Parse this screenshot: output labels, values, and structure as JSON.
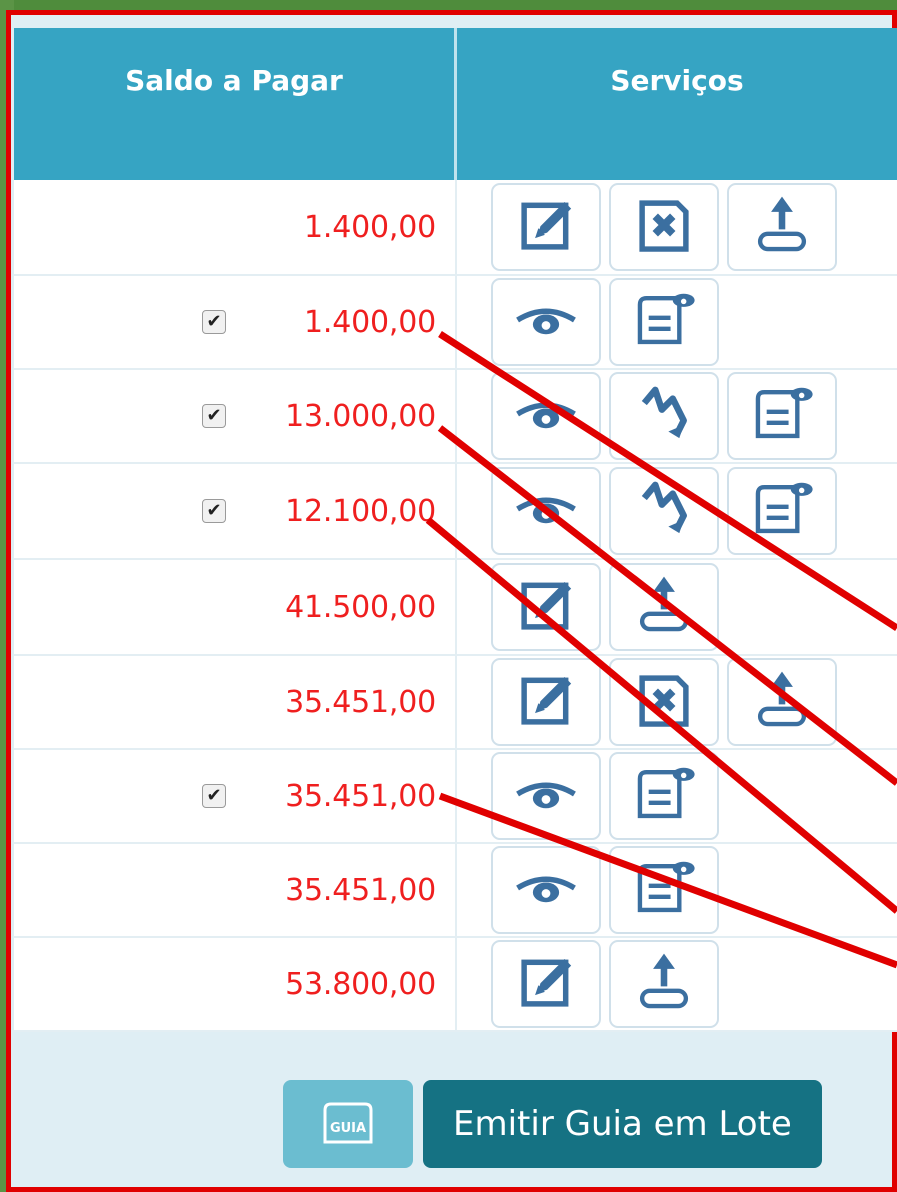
{
  "table": {
    "headers": {
      "saldo": "Saldo a Pagar",
      "servicos": "Serviços"
    },
    "rows": [
      {
        "amount": "1.400,00",
        "checked": false,
        "actions": [
          "edit",
          "delete",
          "upload"
        ]
      },
      {
        "amount": "1.400,00",
        "checked": true,
        "actions": [
          "view",
          "guide"
        ]
      },
      {
        "amount": "13.000,00",
        "checked": true,
        "actions": [
          "view",
          "history",
          "guide"
        ]
      },
      {
        "amount": "12.100,00",
        "checked": true,
        "actions": [
          "view",
          "history",
          "guide"
        ]
      },
      {
        "amount": "41.500,00",
        "checked": false,
        "actions": [
          "edit",
          "upload"
        ]
      },
      {
        "amount": "35.451,00",
        "checked": false,
        "actions": [
          "edit",
          "delete",
          "upload"
        ]
      },
      {
        "amount": "35.451,00",
        "checked": true,
        "actions": [
          "view",
          "guide"
        ]
      },
      {
        "amount": "35.451,00",
        "checked": false,
        "actions": [
          "view",
          "guide"
        ]
      },
      {
        "amount": "53.800,00",
        "checked": false,
        "actions": [
          "edit",
          "upload"
        ]
      }
    ]
  },
  "footer": {
    "guia_icon_label": "GUIA",
    "emitir_label": "Emitir Guia em Lote"
  },
  "icons": {
    "edit": "edit-icon",
    "delete": "delete-icon",
    "upload": "upload-icon",
    "view": "eye-icon",
    "guide": "guide-icon",
    "history": "zigzag-icon"
  },
  "colors": {
    "header_bg": "#36a4c3",
    "amount": "#ef1f1f",
    "icon": "#3b6fa0",
    "lote_button": "#157283",
    "guia_button": "#6bbdd0",
    "annotation": "#e00000"
  }
}
